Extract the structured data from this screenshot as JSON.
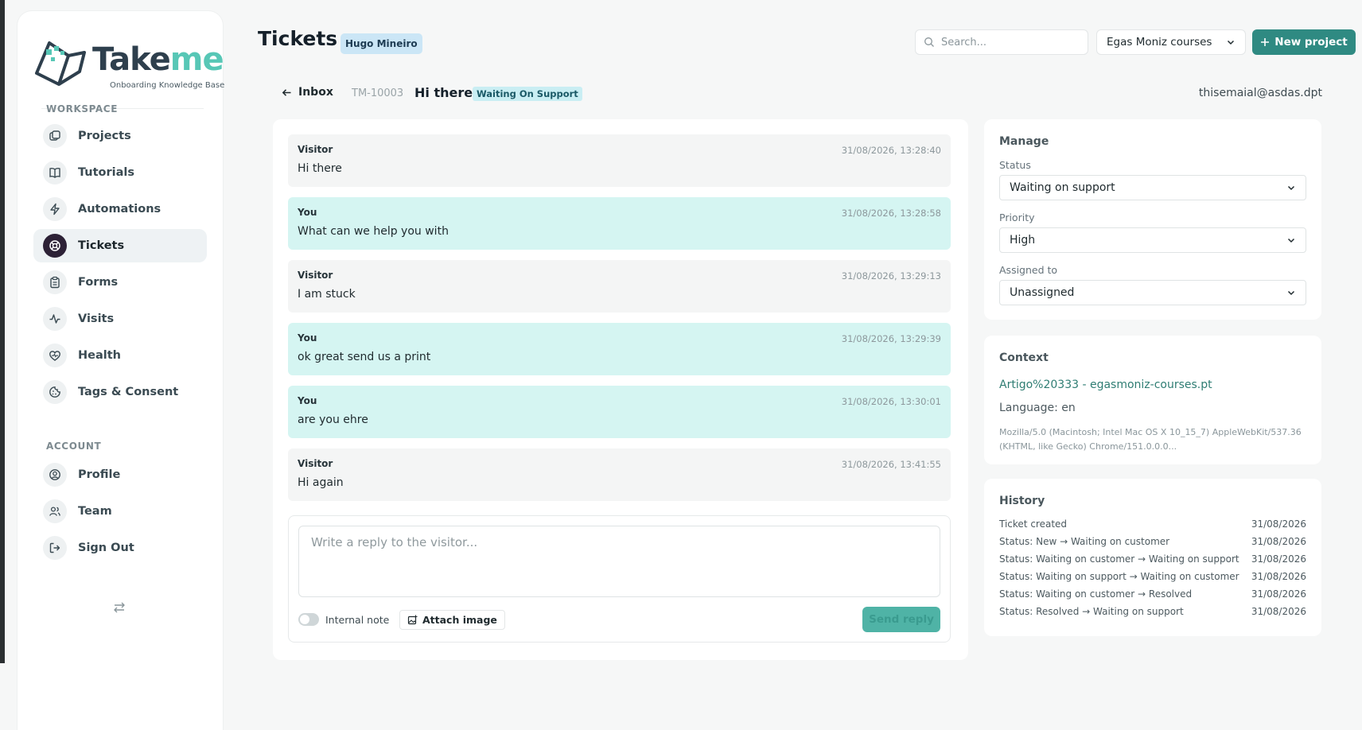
{
  "brand": {
    "name_primary": "Take",
    "name_accent": "me",
    "tagline": "Onboarding Knowledge Base",
    "colors": {
      "primary": "#2f8a82",
      "dark": "#2d2136",
      "accent": "#57c7b6"
    }
  },
  "sidebar": {
    "workspace_label": "WORKSPACE",
    "account_label": "ACCOUNT",
    "workspace_items": [
      {
        "label": "Projects",
        "icon": "projects-icon"
      },
      {
        "label": "Tutorials",
        "icon": "book-icon"
      },
      {
        "label": "Automations",
        "icon": "lightning-icon"
      },
      {
        "label": "Tickets",
        "icon": "lifebuoy-icon",
        "active": true
      },
      {
        "label": "Forms",
        "icon": "clipboard-icon"
      },
      {
        "label": "Visits",
        "icon": "activity-icon"
      },
      {
        "label": "Health",
        "icon": "heart-icon"
      },
      {
        "label": "Tags & Consent",
        "icon": "cookie-icon"
      }
    ],
    "account_items": [
      {
        "label": "Profile",
        "icon": "user-circle-icon"
      },
      {
        "label": "Team",
        "icon": "users-icon"
      },
      {
        "label": "Sign Out",
        "icon": "sign-out-icon"
      }
    ]
  },
  "header": {
    "title": "Tickets",
    "user_badge": "Hugo Mineiro",
    "search_placeholder": "Search...",
    "project_select": "Egas Moniz courses",
    "new_project_label": "New project"
  },
  "ticket": {
    "back_label": "Inbox",
    "id": "TM-10003",
    "subject": "Hi there",
    "status_badge": "Waiting On Support",
    "email": "thisemaial@asdas.dpt"
  },
  "messages": [
    {
      "author": "Visitor",
      "time": "31/08/2026, 13:28:40",
      "text": "Hi there",
      "kind": "visitor"
    },
    {
      "author": "You",
      "time": "31/08/2026, 13:28:58",
      "text": "What can we help you with",
      "kind": "you"
    },
    {
      "author": "Visitor",
      "time": "31/08/2026, 13:29:13",
      "text": "I am stuck",
      "kind": "visitor"
    },
    {
      "author": "You",
      "time": "31/08/2026, 13:29:39",
      "text": "ok great send us a print",
      "kind": "you"
    },
    {
      "author": "You",
      "time": "31/08/2026, 13:30:01",
      "text": "are you ehre",
      "kind": "you"
    },
    {
      "author": "Visitor",
      "time": "31/08/2026, 13:41:55",
      "text": "Hi again",
      "kind": "visitor"
    }
  ],
  "reply": {
    "placeholder": "Write a reply to the visitor...",
    "internal_note_label": "Internal note",
    "attach_label": "Attach image",
    "send_label": "Send reply"
  },
  "manage": {
    "title": "Manage",
    "status_label": "Status",
    "status_value": "Waiting on support",
    "priority_label": "Priority",
    "priority_value": "High",
    "assigned_label": "Assigned to",
    "assigned_value": "Unassigned"
  },
  "context": {
    "title": "Context",
    "link": "Artigo%20333 - egasmoniz-courses.pt",
    "language": "Language: en",
    "user_agent": "Mozilla/5.0 (Macintosh; Intel Mac OS X 10_15_7) AppleWebKit/537.36 (KHTML, like Gecko) Chrome/151.0.0.0..."
  },
  "history": {
    "title": "History",
    "entries": [
      {
        "text": "Ticket created",
        "date": "31/08/2026"
      },
      {
        "text": "Status: New → Waiting on customer",
        "date": "31/08/2026"
      },
      {
        "text": "Status: Waiting on customer → Waiting on support",
        "date": "31/08/2026"
      },
      {
        "text": "Status: Waiting on support → Waiting on customer",
        "date": "31/08/2026"
      },
      {
        "text": "Status: Waiting on customer → Resolved",
        "date": "31/08/2026"
      },
      {
        "text": "Status: Resolved → Waiting on support",
        "date": "31/08/2026"
      }
    ]
  }
}
